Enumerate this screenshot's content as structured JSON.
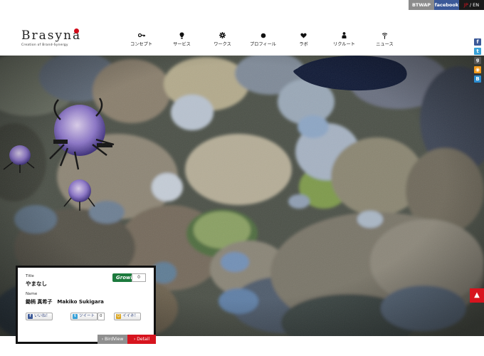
{
  "util": {
    "btwap": "BTWAP",
    "facebook": "facebook",
    "lang_jp": "JP",
    "lang_sep": " / ",
    "lang_en": "EN"
  },
  "logo": {
    "name": "Brasyna",
    "tagline": "Creation of Brand-Synergy",
    "accent": "#d10b1a"
  },
  "nav": [
    {
      "label": "コンセプト",
      "icon": "key-icon"
    },
    {
      "label": "サービス",
      "icon": "bulb-icon"
    },
    {
      "label": "ワークス",
      "icon": "gear-icon"
    },
    {
      "label": "プロフィール",
      "icon": "dot-icon"
    },
    {
      "label": "ラボ",
      "icon": "heart-icon"
    },
    {
      "label": "リクルート",
      "icon": "person-icon"
    },
    {
      "label": "ニュース",
      "icon": "wifi-icon"
    }
  ],
  "share_icons": [
    "facebook-icon",
    "twitter-icon",
    "google-plus-icon",
    "rss-icon",
    "hatena-icon"
  ],
  "panel": {
    "title_label": "Title",
    "title_value": "やまなし",
    "name_label": "Name",
    "name_value": "鋤柄 真希子　Makiko Sukigara",
    "growl_label": "Growl!",
    "growl_count": "0",
    "like_label": "いいね！",
    "tweet_label": "ツイート",
    "tweet_count": "0",
    "iine_label": "イイネ！",
    "birdview_label": "› BirdView",
    "detail_label": "› Detail"
  },
  "colors": {
    "red": "#d7141e",
    "facebook": "#3b5998",
    "growl": "#1c7a3d"
  }
}
